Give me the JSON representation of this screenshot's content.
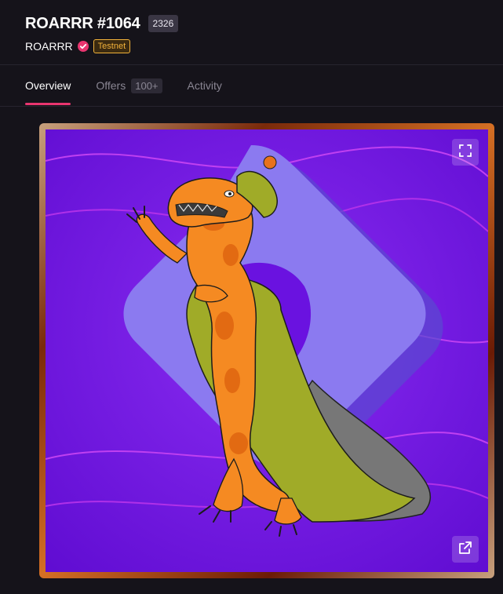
{
  "asset": {
    "title": "ROARRR #1064",
    "rank": "2326",
    "collection": "ROARRR",
    "network_badge": "Testnet"
  },
  "tabs": [
    {
      "label": "Overview",
      "active": true
    },
    {
      "label": "Offers",
      "count": "100+"
    },
    {
      "label": "Activity"
    }
  ],
  "colors": {
    "accent": "#e8356f",
    "testnet": "#f2b23a",
    "background": "#15131a"
  },
  "icons": {
    "verified": "verified-check-icon",
    "expand": "expand-icon",
    "open_external": "external-link-icon"
  }
}
